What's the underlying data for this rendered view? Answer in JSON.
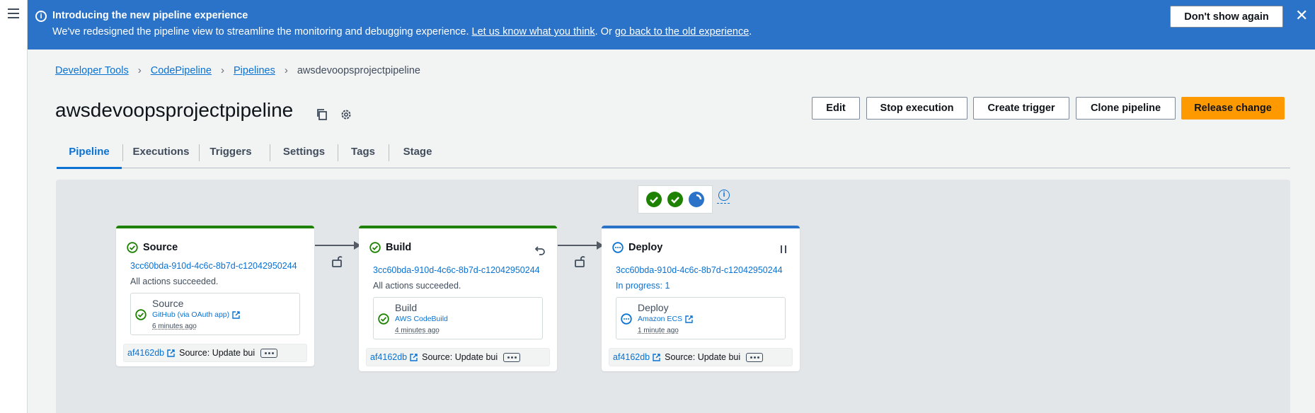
{
  "banner": {
    "title": "Introducing the new pipeline experience",
    "text_before": "We've redesigned the pipeline view to streamline the monitoring and debugging experience. ",
    "link1": "Let us know what you think",
    "text_middle": ". Or ",
    "link2": "go back to the old experience",
    "text_after": ".",
    "dismiss_label": "Don't show again",
    "close_icon": "close-icon"
  },
  "breadcrumb": {
    "items": [
      "Developer Tools",
      "CodePipeline",
      "Pipelines"
    ],
    "current": "awsdevoopsprojectpipeline"
  },
  "page": {
    "title": "awsdevoopsprojectpipeline",
    "copy_icon": "copy-icon",
    "settings_icon": "gear-icon"
  },
  "actions": {
    "edit": "Edit",
    "stop": "Stop execution",
    "trigger": "Create trigger",
    "clone": "Clone pipeline",
    "release": "Release change"
  },
  "tabs": [
    "Pipeline",
    "Executions",
    "Triggers",
    "Settings",
    "Tags",
    "Stage"
  ],
  "active_tab": "Pipeline",
  "colors": {
    "success": "#1d8102",
    "in_progress": "#2b73c8",
    "link": "#0972d3",
    "primary": "#ff9900",
    "banner": "#2b73c8"
  },
  "stages": [
    {
      "name": "Source",
      "status": "succeeded",
      "execution_id": "3cc60bda-910d-4c6c-8b7d-c12042950244",
      "summary": "All actions succeeded.",
      "action": {
        "name": "Source",
        "provider": "GitHub (via OAuth app)",
        "time": "6 minutes ago"
      },
      "commit": {
        "id": "af4162db",
        "message": "Source: Update bui"
      }
    },
    {
      "name": "Build",
      "status": "succeeded",
      "execution_id": "3cc60bda-910d-4c6c-8b7d-c12042950244",
      "summary": "All actions succeeded.",
      "action": {
        "name": "Build",
        "provider": "AWS CodeBuild",
        "time": "4 minutes ago"
      },
      "commit": {
        "id": "af4162db",
        "message": "Source: Update bui"
      }
    },
    {
      "name": "Deploy",
      "status": "in-progress",
      "execution_id": "3cc60bda-910d-4c6c-8b7d-c12042950244",
      "summary": "In progress: 1",
      "action": {
        "name": "Deploy",
        "provider": "Amazon ECS",
        "time": "1 minute ago"
      },
      "commit": {
        "id": "af4162db",
        "message": "Source: Update bui"
      }
    }
  ]
}
